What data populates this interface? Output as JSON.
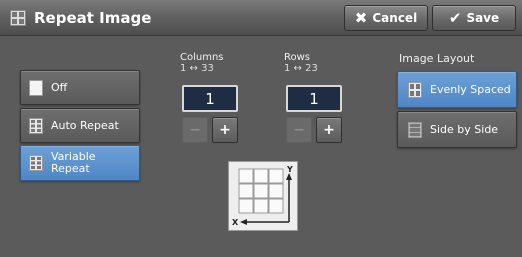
{
  "header": {
    "title": "Repeat Image",
    "title_icon": "repeat-image-icon",
    "cancel_label": "Cancel",
    "save_label": "Save"
  },
  "options": [
    {
      "label": "Off",
      "icon": "blank-page-icon",
      "selected": false
    },
    {
      "label": "Auto Repeat",
      "icon": "auto-repeat-icon",
      "selected": false
    },
    {
      "label": "Variable Repeat",
      "icon": "variable-repeat-icon",
      "selected": true
    }
  ],
  "columns": {
    "label": "Columns",
    "range": "1 ↔ 33",
    "value": "1"
  },
  "rows": {
    "label": "Rows",
    "range": "1 ↔ 23",
    "value": "1"
  },
  "layout": {
    "label": "Image Layout",
    "options": [
      {
        "label": "Evenly Spaced",
        "icon": "evenly-spaced-icon",
        "selected": true
      },
      {
        "label": "Side by Side",
        "icon": "side-by-side-icon",
        "selected": false
      }
    ]
  },
  "diagram": {
    "x_label": "X",
    "y_label": "Y"
  },
  "colors": {
    "background": "#5b5b5b",
    "selected": "#5b8fcc",
    "value_box": "#1e2c44"
  }
}
